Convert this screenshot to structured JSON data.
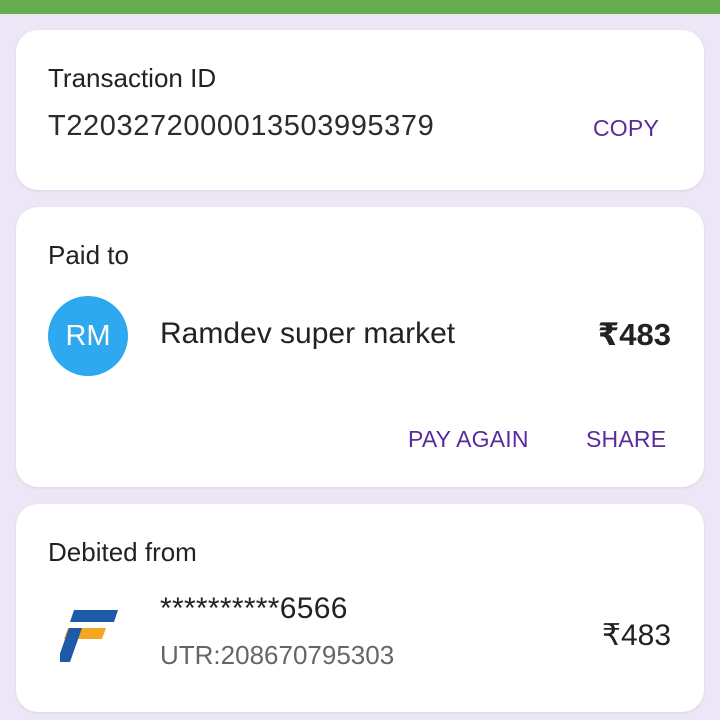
{
  "transaction": {
    "heading": "Transaction ID",
    "id": "T2203272000013503995379",
    "copy_label": "COPY"
  },
  "paid_to": {
    "heading": "Paid to",
    "avatar_initials": "RM",
    "avatar_color": "#2ea8ef",
    "payee_name": "Ramdev super market",
    "amount": "₹483",
    "pay_again_label": "PAY AGAIN",
    "share_label": "SHARE"
  },
  "debited_from": {
    "heading": "Debited from",
    "bank_icon": "federal-bank-logo-icon",
    "account": "**********6566",
    "utr": "UTR:208670795303",
    "amount": "₹483"
  },
  "colors": {
    "accent": "#5a2a9e",
    "background": "#ece6f6",
    "top_bar": "#67ad4f"
  }
}
